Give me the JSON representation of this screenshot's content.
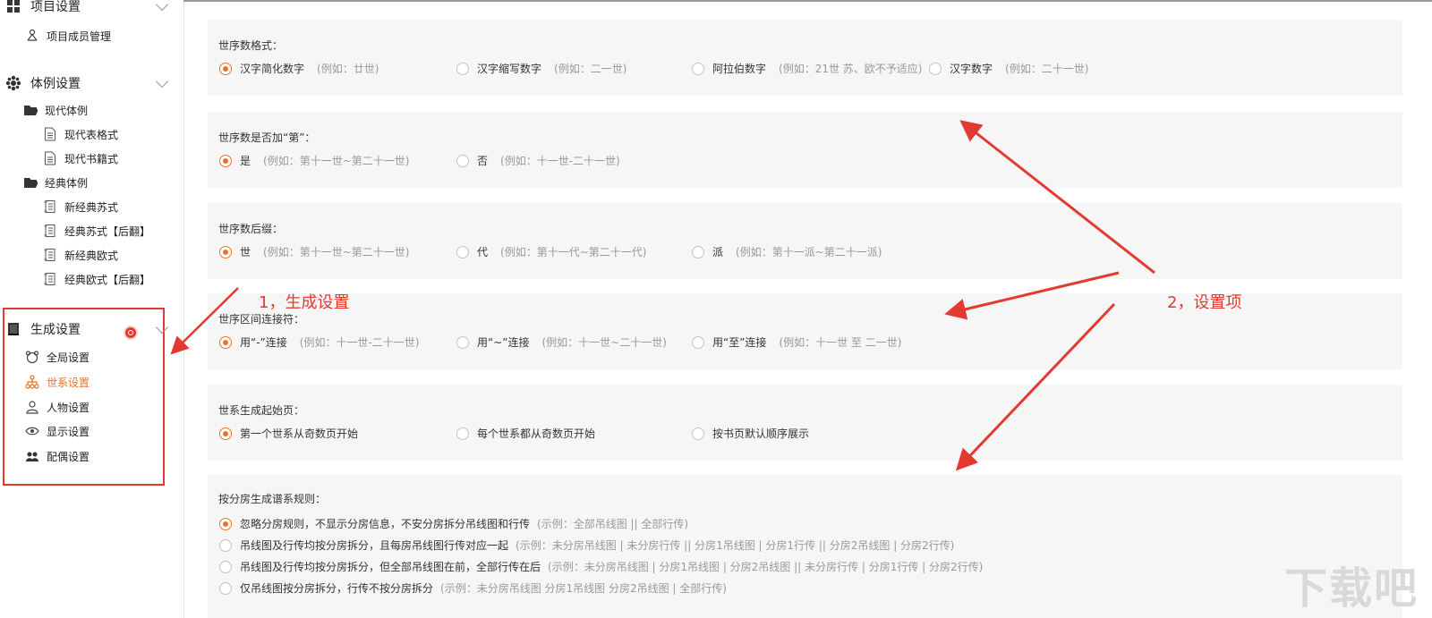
{
  "sidebar": {
    "project": {
      "label": "项目设置",
      "items": [
        {
          "label": "项目成员管理"
        }
      ]
    },
    "style": {
      "label": "体例设置",
      "modern": {
        "label": "现代体例",
        "items": [
          {
            "label": "现代表格式"
          },
          {
            "label": "现代书籍式"
          }
        ]
      },
      "classic": {
        "label": "经典体例",
        "items": [
          {
            "label": "新经典苏式"
          },
          {
            "label": "经典苏式【后翻】"
          },
          {
            "label": "新经典欧式"
          },
          {
            "label": "经典欧式【后翻】"
          }
        ]
      }
    },
    "generate": {
      "label": "生成设置",
      "items": [
        {
          "label": "全局设置"
        },
        {
          "label": "世系设置"
        },
        {
          "label": "人物设置"
        },
        {
          "label": "显示设置"
        },
        {
          "label": "配偶设置"
        }
      ],
      "active_index": 1
    }
  },
  "main": {
    "panels": [
      {
        "title": "世序数格式：",
        "options": [
          {
            "label": "汉字简化数字",
            "example": "(例如：廿世)",
            "selected": true
          },
          {
            "label": "汉字缩写数字",
            "example": "(例如：二一世)",
            "selected": false
          },
          {
            "label": "阿拉伯数字",
            "example": "(例如：21世 苏、欧不予适应)",
            "selected": false
          },
          {
            "label": "汉字数字",
            "example": "(例如：二十一世)",
            "selected": false
          }
        ]
      },
      {
        "title": "世序数是否加“第”：",
        "options": [
          {
            "label": "是",
            "example": "(例如：第十一世~第二十一世)",
            "selected": true
          },
          {
            "label": "否",
            "example": "(例如：十一世-二十一世)",
            "selected": false
          }
        ]
      },
      {
        "title": "世序数后缀：",
        "options": [
          {
            "label": "世",
            "example": "(例如：第十一世~第二十一世)",
            "selected": true
          },
          {
            "label": "代",
            "example": "(例如：第十一代~第二十一代)",
            "selected": false
          },
          {
            "label": "派",
            "example": "(例如：第十一派~第二十一派)",
            "selected": false
          }
        ]
      },
      {
        "title": "世序区间连接符：",
        "options": [
          {
            "label": "用“-”连接",
            "example": "(例如：十一世-二十一世)",
            "selected": true
          },
          {
            "label": "用“~”连接",
            "example": "(例如：十一世~二十一世)",
            "selected": false
          },
          {
            "label": "用“至”连接",
            "example": "(例如：十一世 至 二一世)",
            "selected": false
          }
        ]
      },
      {
        "title": "世系生成起始页：",
        "options": [
          {
            "label": "第一个世系从奇数页开始",
            "example": "",
            "selected": true
          },
          {
            "label": "每个世系都从奇数页开始",
            "example": "",
            "selected": false
          },
          {
            "label": "按书页默认顺序展示",
            "example": "",
            "selected": false
          }
        ]
      },
      {
        "title": "按分房生成谱系规则：",
        "options": [
          {
            "label": "忽略分房规则，不显示分房信息，不安分房拆分吊线图和行传",
            "example": "(示例：全部吊线图 || 全部行传)",
            "selected": true
          },
          {
            "label": "吊线图及行传均按分房拆分，且每房吊线图行传对应一起",
            "example": "(示例：未分房吊线图 | 未分房行传 || 分房1吊线图 | 分房1行传 || 分房2吊线图 | 分房2行传)",
            "selected": false
          },
          {
            "label": "吊线图及行传均按分房拆分，但全部吊线图在前，全部行传在后",
            "example": "(示例：未分房吊线图 | 分房1吊线图 | 分房2吊线图 || 未分房行传 | 分房1行传 | 分房2行传)",
            "selected": false
          },
          {
            "label": "仅吊线图按分房拆分，行传不按分房拆分",
            "example": "(示例：未分房吊线图 分房1吊线图 分房2吊线图 | 全部行传)",
            "selected": false
          }
        ]
      }
    ]
  },
  "annotations": {
    "label1": "1，生成设置",
    "label2": "2，设置项",
    "color": "#e23a2f"
  },
  "watermark": "下载吧",
  "colors": {
    "accent": "#e8742b",
    "panel_bg": "#f6f6f6",
    "annotation": "#e23a2f"
  }
}
